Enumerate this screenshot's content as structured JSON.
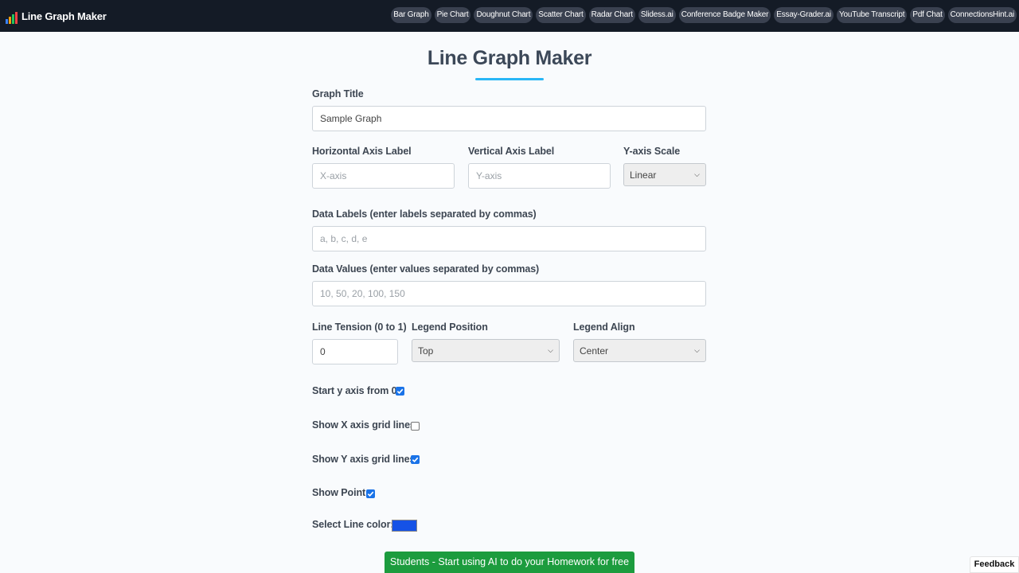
{
  "navbar": {
    "brand": "Line Graph Maker",
    "brand_icon": "bar-chart-icon",
    "brand_colors": [
      "#3b82f6",
      "#f59e0b",
      "#22c55e",
      "#ef4444"
    ],
    "links": [
      "Bar Graph",
      "Pie Chart",
      "Doughnut Chart",
      "Scatter Chart",
      "Radar Chart",
      "Slidess.ai",
      "Conference Badge Maker",
      "Essay-Grader.ai",
      "YouTube Transcript",
      "Pdf Chat",
      "ConnectionsHint.ai"
    ]
  },
  "page": {
    "heading": "Line Graph Maker",
    "accent_color": "#29b6f6"
  },
  "form": {
    "graph_title": {
      "label": "Graph Title",
      "value": "Sample Graph"
    },
    "x_label": {
      "label": "Horizontal Axis Label",
      "placeholder": "X-axis"
    },
    "y_label": {
      "label": "Vertical Axis Label",
      "placeholder": "Y-axis"
    },
    "y_scale": {
      "label": "Y-axis Scale",
      "value": "Linear"
    },
    "data_labels": {
      "label": "Data Labels (enter labels separated by commas)",
      "placeholder": "a, b, c, d, e"
    },
    "data_values": {
      "label": "Data Values (enter values separated by commas)",
      "placeholder": "10, 50, 20, 100, 150"
    },
    "line_tension": {
      "label": "Line Tension (0 to 1)",
      "value": "0"
    },
    "legend_position": {
      "label": "Legend Position",
      "value": "Top"
    },
    "legend_align": {
      "label": "Legend Align",
      "value": "Center"
    },
    "start_y_zero": {
      "label": "Start y axis from 0",
      "checked": true
    },
    "show_x_grid": {
      "label": "Show X axis grid lines",
      "checked": false
    },
    "show_y_grid": {
      "label": "Show Y axis grid lines",
      "checked": true
    },
    "show_point": {
      "label": "Show Point",
      "checked": true
    },
    "line_color": {
      "label": "Select Line color:",
      "value": "#1552e6"
    }
  },
  "cta": {
    "label": "Students - Start using AI to do your Homework for free",
    "color": "#1c9c3e"
  },
  "feedback": {
    "label": "Feedback"
  }
}
